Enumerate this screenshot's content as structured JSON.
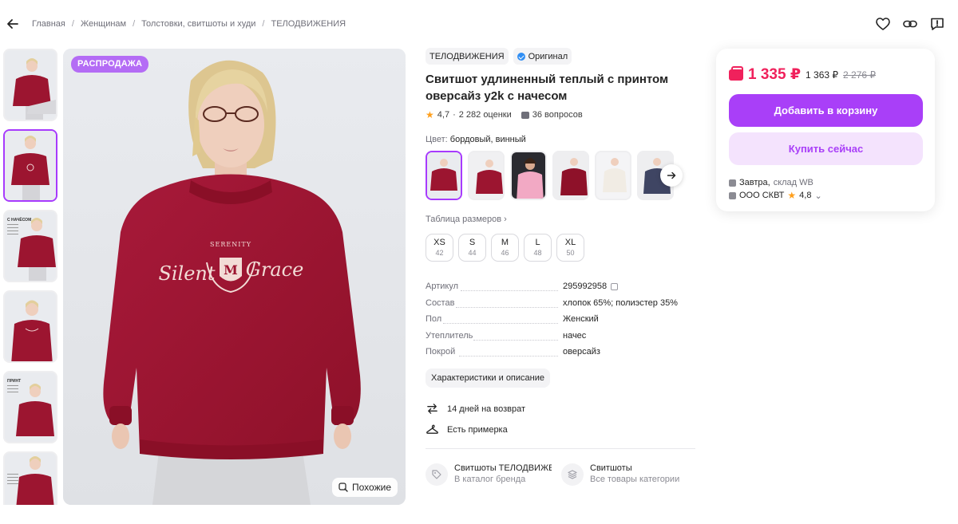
{
  "breadcrumb": [
    "Главная",
    "Женщинам",
    "Толстовки, свитшоты и худи",
    "ТЕЛОДВИЖЕНИЯ"
  ],
  "gallery": {
    "sale_badge": "РАСПРОДАЖА",
    "similar_label": "Похожие",
    "thumb_labels": [
      "",
      "",
      "С НАЧЁСОМ",
      "",
      "ПРИНТ",
      ""
    ],
    "print_text": {
      "top": "SERENITY",
      "left": "Silent",
      "right": "Grace"
    }
  },
  "product": {
    "brand": "ТЕЛОДВИЖЕНИЯ",
    "original_label": "Оригинал",
    "title": "Свитшот удлиненный теплый с принтом оверсайз y2k с начесом",
    "rating": "4,7",
    "reviews": "2 282 оценки",
    "questions": "36 вопросов",
    "color_label": "Цвет:",
    "color_value": "бордовый, винный",
    "size_table_label": "Таблица размеров",
    "sizes": [
      {
        "label": "XS",
        "ru": "42"
      },
      {
        "label": "S",
        "ru": "44"
      },
      {
        "label": "M",
        "ru": "46"
      },
      {
        "label": "L",
        "ru": "48"
      },
      {
        "label": "XL",
        "ru": "50"
      }
    ],
    "specs": [
      {
        "key": "Артикул",
        "value": "295992958"
      },
      {
        "key": "Состав",
        "value": "хлопок 65%; полиэстер 35%"
      },
      {
        "key": "Пол",
        "value": "Женский"
      },
      {
        "key": "Утеплитель",
        "value": "начес"
      },
      {
        "key": "Покрой",
        "value": "оверсайз"
      }
    ],
    "desc_button": "Характеристики и описание",
    "features": [
      "14 дней на возврат",
      "Есть примерка"
    ],
    "links": [
      {
        "title": "Свитшоты ТЕЛОДВИЖЕНИЯ",
        "sub": "В каталог бренда"
      },
      {
        "title": "Свитшоты",
        "sub": "Все товары категории"
      }
    ]
  },
  "buy": {
    "price": "1 335 ₽",
    "price_wallet": "1 363 ₽",
    "price_old": "2 276 ₽",
    "add_to_cart": "Добавить в корзину",
    "buy_now": "Купить сейчас",
    "delivery_when": "Завтра,",
    "delivery_where": "склад WB",
    "seller": "ООО СКВТ",
    "seller_rating": "4,8"
  },
  "colors": {
    "accent": "#a93ff8",
    "price": "#f0215c",
    "sweater": "#9c1530",
    "badge": "#b46cf5"
  }
}
